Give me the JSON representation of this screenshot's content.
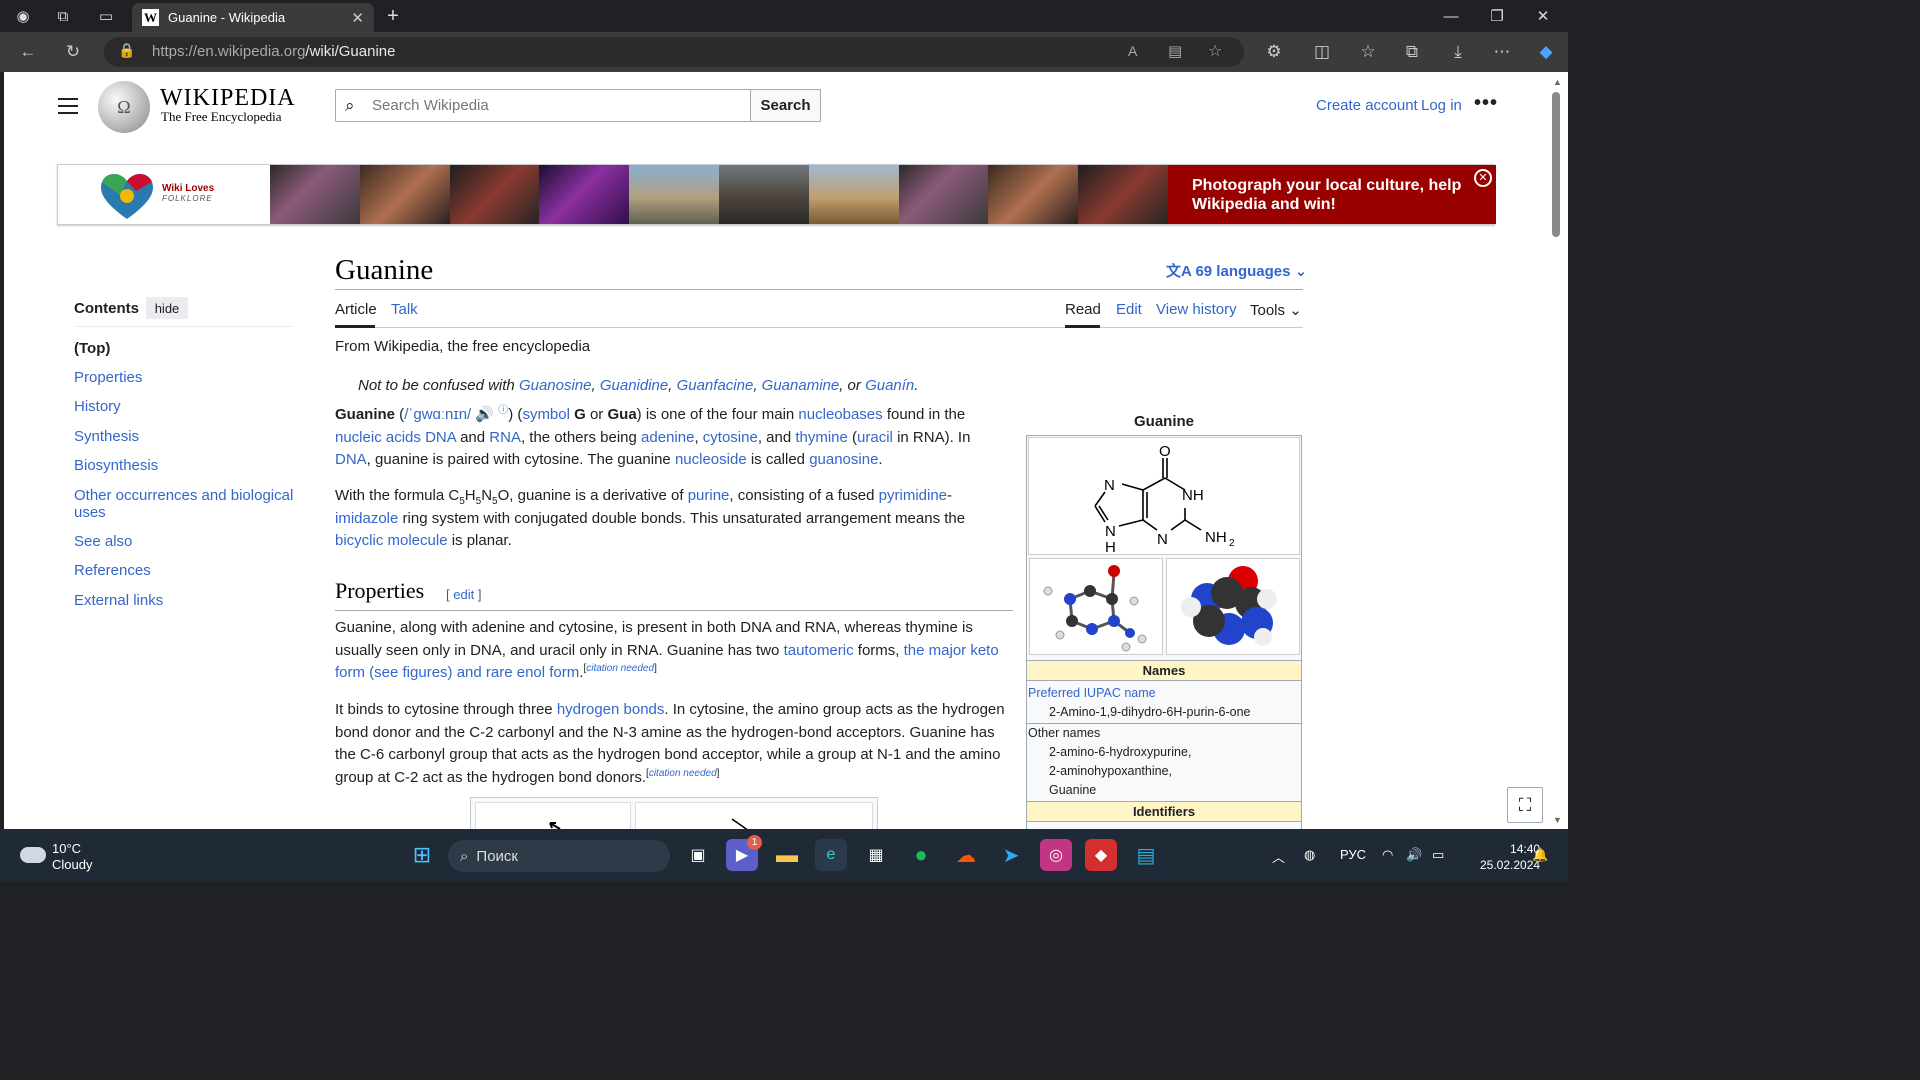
{
  "browser": {
    "tab_title": "Guanine - Wikipedia",
    "url_host": "https://en.wikipedia.org",
    "url_path": "/wiki/Guanine"
  },
  "wiki": {
    "wordmark": "WIKIPEDIA",
    "tagline": "The Free Encyclopedia",
    "search_placeholder": "Search Wikipedia",
    "search_button": "Search",
    "create_account": "Create account",
    "login": "Log in"
  },
  "banner": {
    "brand": "Wiki Loves",
    "sub": "FOLKLORE",
    "cta": "Photograph your local culture, help Wikipedia and win!"
  },
  "toc": {
    "title": "Contents",
    "hide": "hide",
    "items": [
      "(Top)",
      "Properties",
      "History",
      "Synthesis",
      "Biosynthesis",
      "Other occurrences and biological uses",
      "See also",
      "References",
      "External links"
    ]
  },
  "article": {
    "title": "Guanine",
    "languages": "69 languages",
    "tab_article": "Article",
    "tab_talk": "Talk",
    "tab_read": "Read",
    "tab_edit": "Edit",
    "tab_history": "View history",
    "tab_tools": "Tools",
    "from": "From Wikipedia, the free encyclopedia",
    "h2": "Properties",
    "h2_edit": "edit"
  },
  "infobox": {
    "caption": "Guanine",
    "names": "Names",
    "iupac_label": "Preferred IUPAC name",
    "iupac_value": "2-Amino-1,9-dihydro-6H-purin-6-one",
    "other_label": "Other names",
    "other1": "2-amino-6-hydroxypurine,",
    "other2": "2-aminohypoxanthine,",
    "other3": "Guanine",
    "identifiers": "Identifiers"
  },
  "taskbar": {
    "temp": "10°C",
    "cond": "Cloudy",
    "search": "Поиск",
    "lang": "РУС",
    "time": "14:40",
    "date": "25.02.2024",
    "badge": "1"
  }
}
